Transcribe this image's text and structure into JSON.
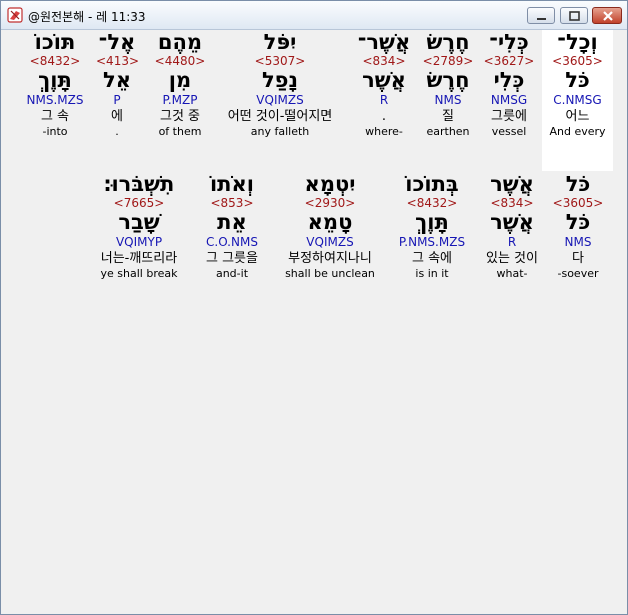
{
  "window": {
    "title": "@원전본해 - 레 11:33"
  },
  "rows": [
    [
      {
        "hebrew": "וְכָל־",
        "strong": "<3605>",
        "lemma": "כֹּל",
        "morph": "C.NMSG",
        "korean": "어느",
        "english": "And every",
        "selected": true
      },
      {
        "hebrew": "כְּלִי־",
        "strong": "<3627>",
        "lemma": "כְּלִי",
        "morph": "NMSG",
        "korean": "그릇에",
        "english": "vessel",
        "selected": false
      },
      {
        "hebrew": "חֶרֶשׂ",
        "strong": "<2789>",
        "lemma": "חֶרֶשׂ",
        "morph": "NMS",
        "korean": "질",
        "english": "earthen",
        "selected": false
      },
      {
        "hebrew": "אֲשֶׁר־",
        "strong": "<834>",
        "lemma": "אֲשֶׁר",
        "morph": "R",
        "korean": ".",
        "english": "where-",
        "selected": false
      },
      {
        "hebrew": "יִפֹּל",
        "strong": "<5307>",
        "lemma": "נָפַל",
        "morph": "VQIMZS",
        "korean": "어떤 것이-떨어지면",
        "english": "any falleth",
        "selected": false
      },
      {
        "hebrew": "מֵהֶם",
        "strong": "<4480>",
        "lemma": "מִן",
        "morph": "P.MZP",
        "korean": "그것 중",
        "english": "of them",
        "selected": false
      },
      {
        "hebrew": "אֶל־",
        "strong": "<413>",
        "lemma": "אֵל",
        "morph": "P",
        "korean": "에",
        "english": ".",
        "selected": false
      },
      {
        "hebrew": "תּוֹכוֹ",
        "strong": "<8432>",
        "lemma": "תָּוֶךְ",
        "morph": "NMS.MZS",
        "korean": "그 속",
        "english": "-into",
        "selected": false
      }
    ],
    [
      {
        "hebrew": "כֹּל",
        "strong": "<3605>",
        "lemma": "כֹּל",
        "morph": "NMS",
        "korean": "다",
        "english": "-soever",
        "selected": false
      },
      {
        "hebrew": "אֲשֶׁר",
        "strong": "<834>",
        "lemma": "אֲשֶׁר",
        "morph": "R",
        "korean": "있는 것이",
        "english": "what-",
        "selected": false
      },
      {
        "hebrew": "בְּתוֹכוֹ",
        "strong": "<8432>",
        "lemma": "תָּוֶךְ",
        "morph": "P.NMS.MZS",
        "korean": "그 속에",
        "english": "is in it",
        "selected": false
      },
      {
        "hebrew": "יִטְמָא",
        "strong": "<2930>",
        "lemma": "טָמֵא",
        "morph": "VQIMZS",
        "korean": "부정하여지나니",
        "english": "shall be unclean",
        "selected": false
      },
      {
        "hebrew": "וְאֹתוֹ",
        "strong": "<853>",
        "lemma": "אֵת",
        "morph": "C.O.NMS",
        "korean": "그 그릇을",
        "english": "and-it",
        "selected": false
      },
      {
        "hebrew": "תִשְׁבֹּרוּ׃",
        "strong": "<7665>",
        "lemma": "שָׁבַר",
        "morph": "VQIMYP",
        "korean": "너는-깨뜨리라",
        "english": "ye shall break",
        "selected": false
      }
    ]
  ]
}
